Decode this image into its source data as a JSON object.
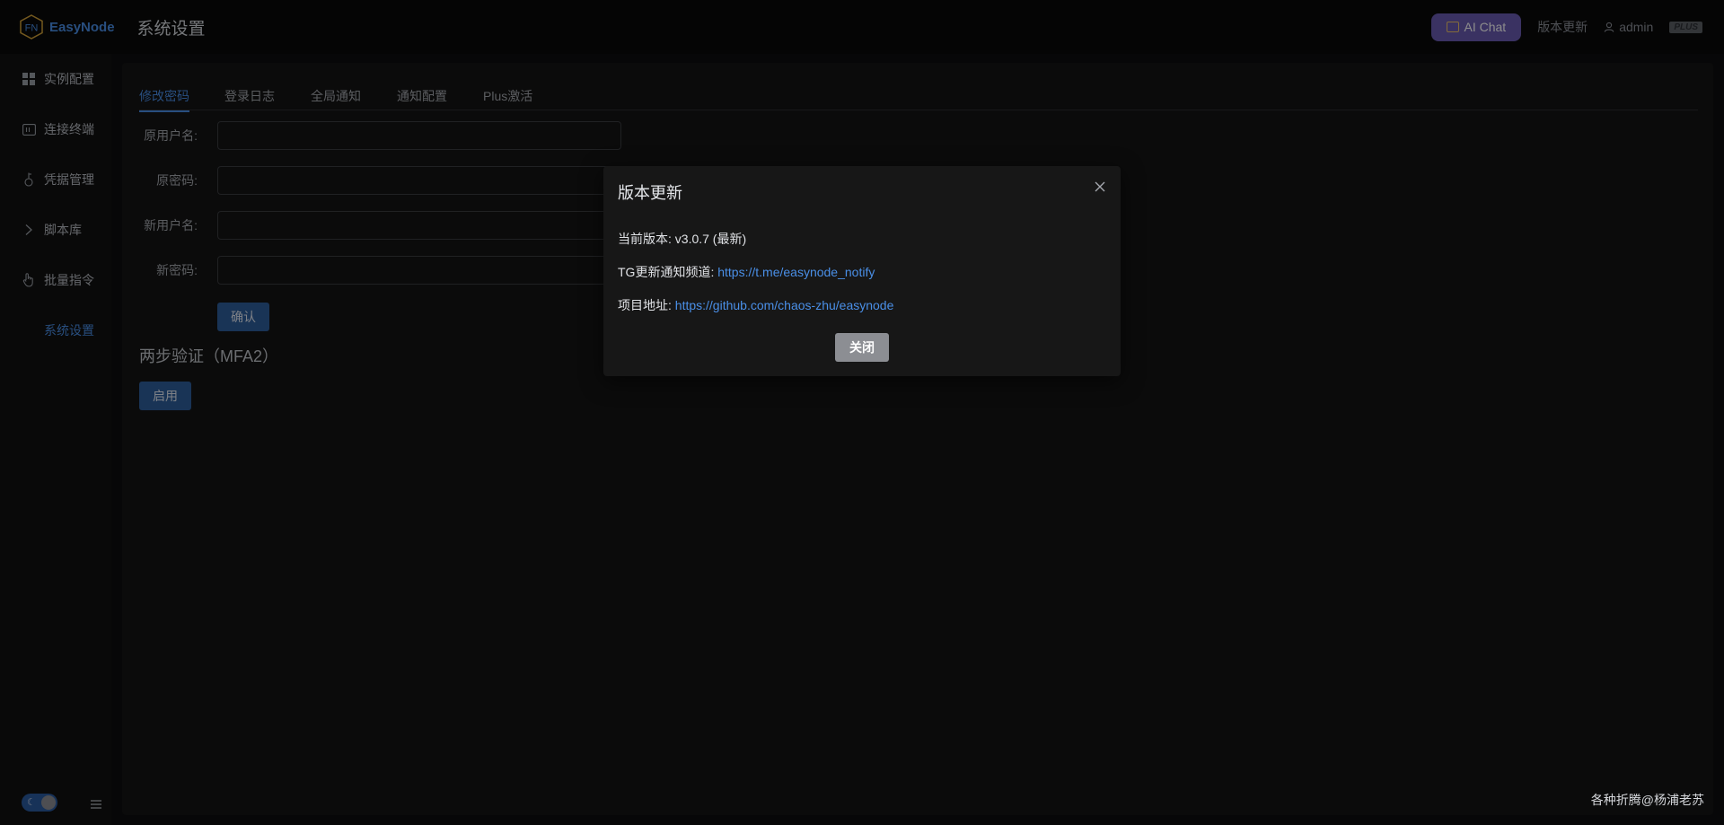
{
  "header": {
    "logo_mark": "FN",
    "logo_text": "EasyNode",
    "page_title": "系统设置",
    "ai_chat_label": "AI Chat",
    "version_update_label": "版本更新",
    "user_name": "admin",
    "plus_badge": "PLUS"
  },
  "sidebar": {
    "items": [
      {
        "label": "实例配置",
        "icon": "grid-icon"
      },
      {
        "label": "连接终端",
        "icon": "terminal-icon"
      },
      {
        "label": "凭据管理",
        "icon": "key-icon"
      },
      {
        "label": "脚本库",
        "icon": "chevron-right-icon"
      },
      {
        "label": "批量指令",
        "icon": "pointer-icon"
      },
      {
        "label": "系统设置",
        "icon": "settings-icon",
        "active": true
      }
    ],
    "theme": "dark"
  },
  "tabs": [
    {
      "label": "修改密码",
      "active": true
    },
    {
      "label": "登录日志"
    },
    {
      "label": "全局通知"
    },
    {
      "label": "通知配置"
    },
    {
      "label": "Plus激活"
    }
  ],
  "form": {
    "old_username_label": "原用户名:",
    "old_password_label": "原密码:",
    "new_username_label": "新用户名:",
    "new_password_label": "新密码:",
    "confirm_label": "确认"
  },
  "mfa": {
    "title": "两步验证（MFA2）",
    "enable_label": "启用"
  },
  "dialog": {
    "title": "版本更新",
    "current_version_label": "当前版本:",
    "current_version_value": "v3.0.7 (最新)",
    "tg_label": "TG更新通知频道:",
    "tg_link": "https://t.me/easynode_notify",
    "project_label": "项目地址:",
    "project_link": "https://github.com/chaos-zhu/easynode",
    "close_label": "关闭"
  },
  "footer_note": "各种折腾@杨浦老苏"
}
